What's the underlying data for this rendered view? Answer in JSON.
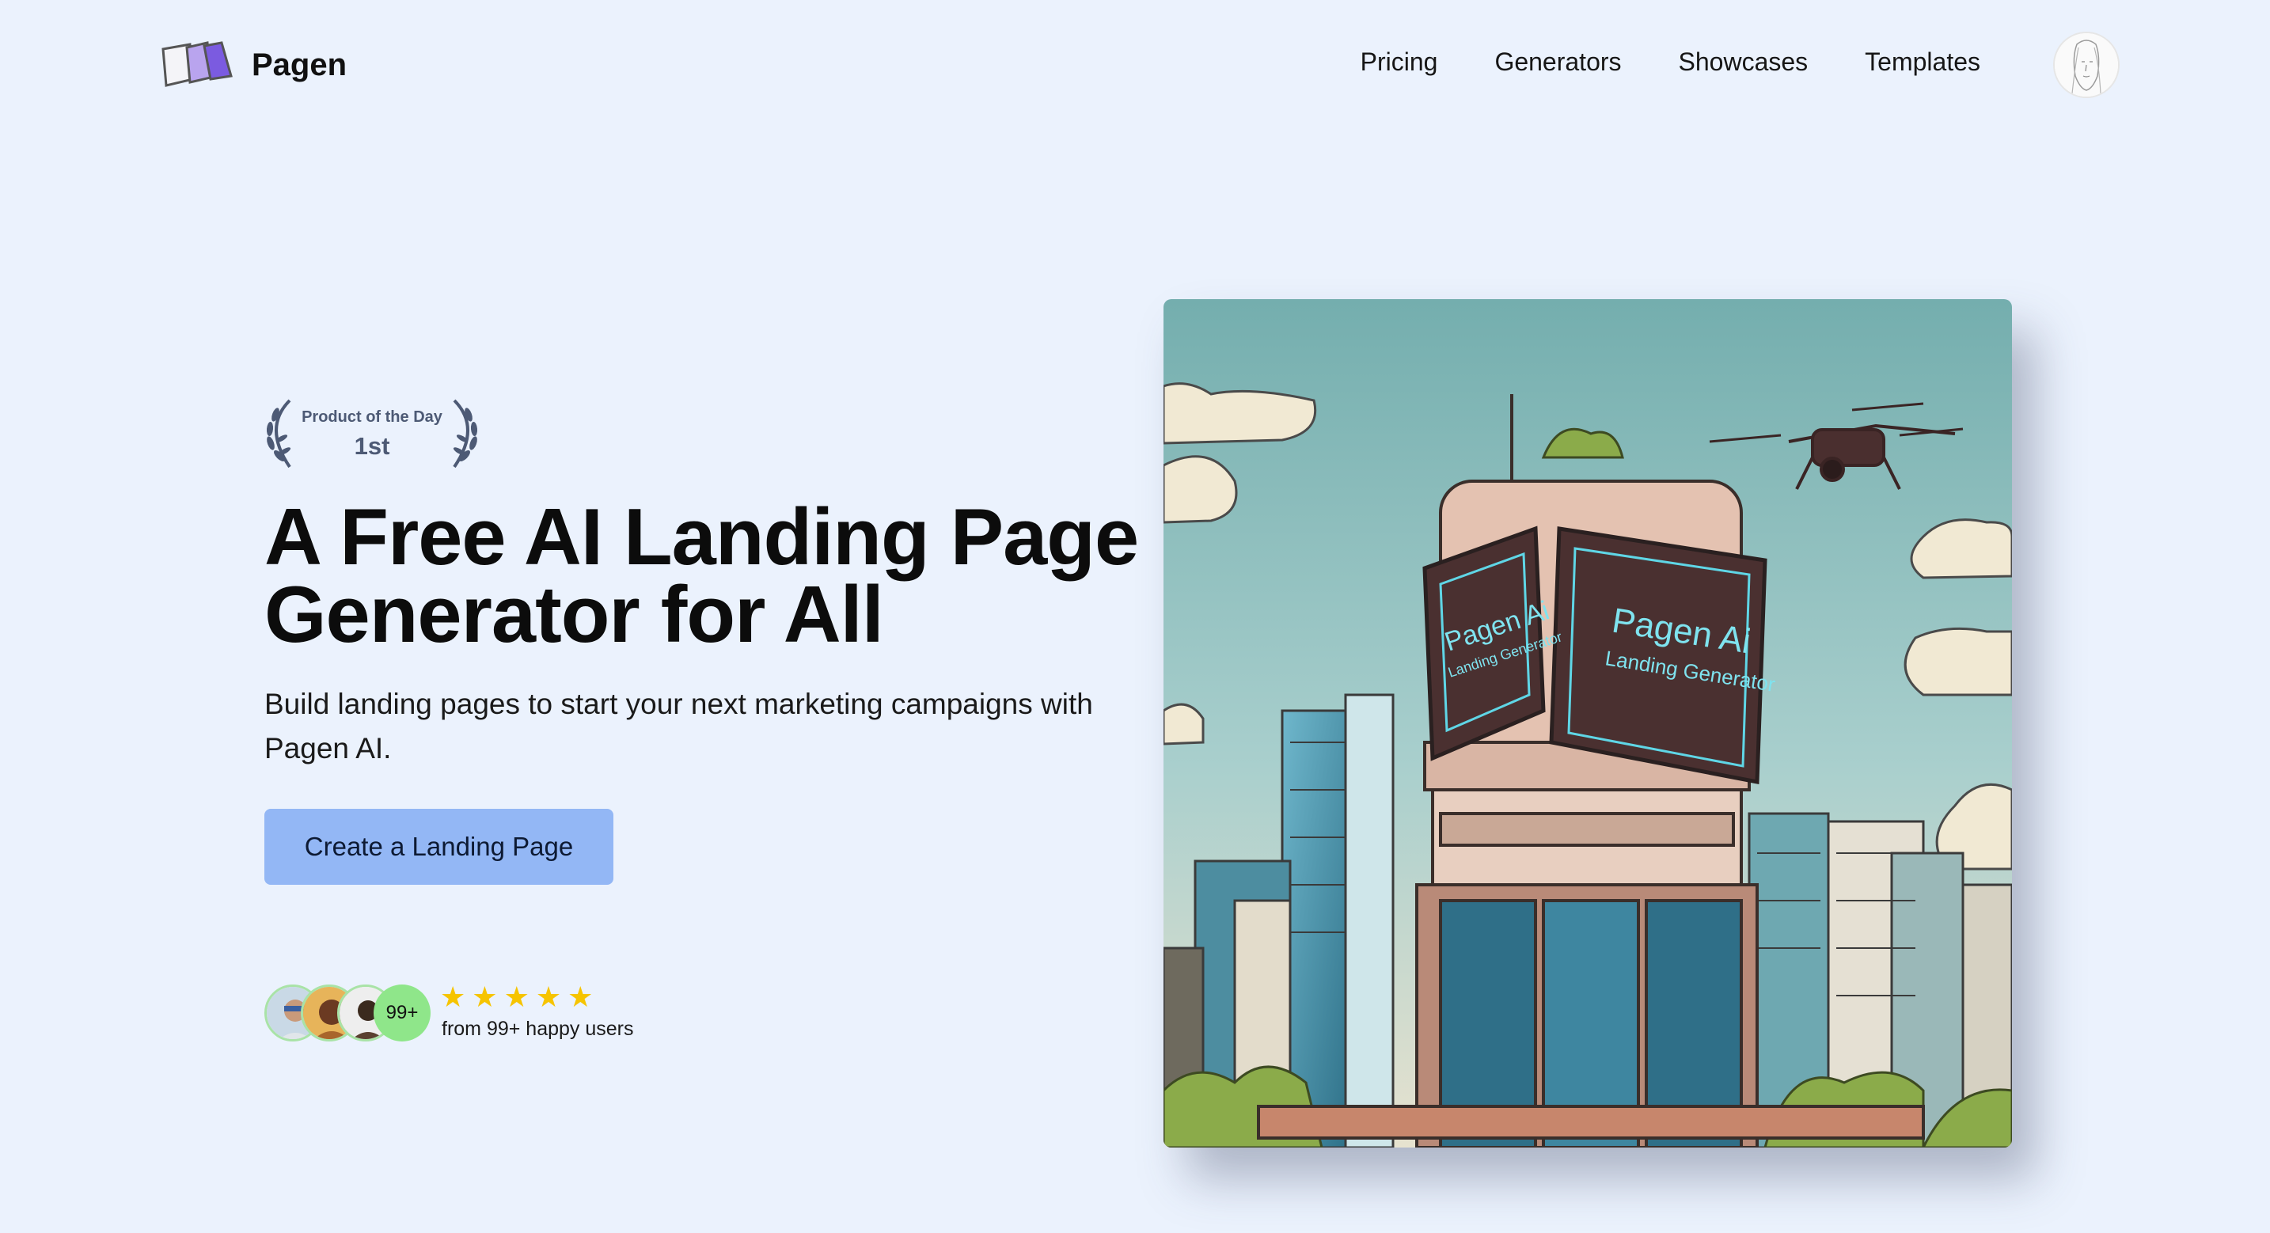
{
  "header": {
    "brand": "Pagen",
    "nav": [
      "Pricing",
      "Generators",
      "Showcases",
      "Templates"
    ]
  },
  "hero": {
    "badge": {
      "line1": "Product of the Day",
      "line2": "1st"
    },
    "title": "A Free AI Landing Page Generator for All",
    "subtitle": "Build landing pages to start your next marketing campaigns with Pagen AI.",
    "cta_label": "Create a Landing Page",
    "social_proof": {
      "count_badge": "99+",
      "rating": 5,
      "text": "from 99+ happy users"
    },
    "image_screen": {
      "left_title": "Pagen Ai",
      "left_sub": "Landing Generator",
      "right_title": "Pagen Ai",
      "right_sub": "Landing Generator"
    }
  },
  "colors": {
    "background": "#ebf2fd",
    "cta": "#93b7f5",
    "star": "#f6c400",
    "avatar_badge": "#8fe68a"
  }
}
